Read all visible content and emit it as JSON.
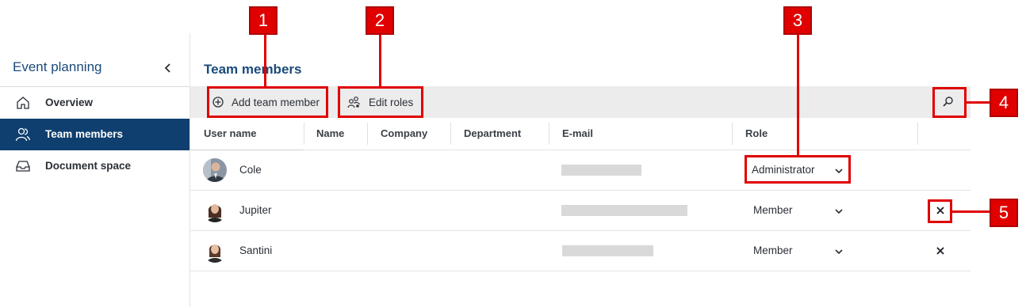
{
  "sidebar": {
    "title": "Event planning",
    "items": [
      {
        "label": "Overview",
        "icon": "home-icon"
      },
      {
        "label": "Team members",
        "icon": "users-icon",
        "active": true
      },
      {
        "label": "Document space",
        "icon": "inbox-icon"
      }
    ]
  },
  "main": {
    "title": "Team members",
    "toolbar": {
      "add_label": "Add team member",
      "edit_roles_label": "Edit roles"
    },
    "columns": [
      "User name",
      "Name",
      "Company",
      "Department",
      "E-mail",
      "Role"
    ],
    "rows": [
      {
        "user": "Cole",
        "role": "Administrator",
        "removable": false
      },
      {
        "user": "Jupiter",
        "role": "Member",
        "removable": true
      },
      {
        "user": "Santini",
        "role": "Member",
        "removable": true
      }
    ]
  },
  "annotations": [
    "1",
    "2",
    "3",
    "4",
    "5"
  ],
  "colors": {
    "accent": "#0f3f6e",
    "title": "#1b4a7a",
    "marker": "#e00000",
    "toolbar_bg": "#ececec"
  }
}
